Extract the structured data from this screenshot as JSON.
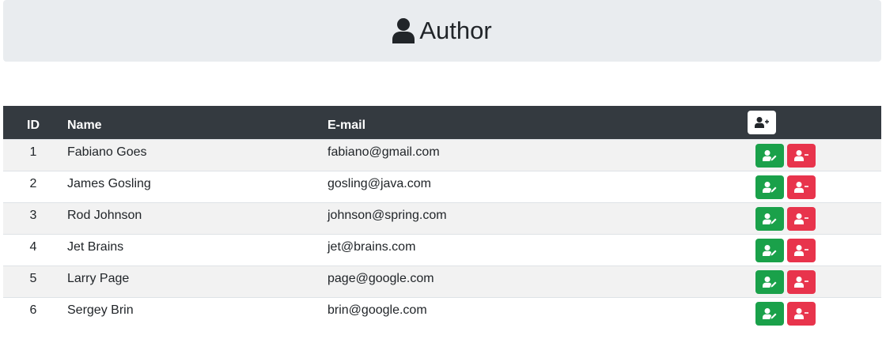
{
  "header": {
    "title": "Author",
    "icon": "user-icon"
  },
  "table": {
    "columns": {
      "id": "ID",
      "name": "Name",
      "email": "E-mail"
    },
    "add_icon": "user-plus-icon",
    "edit_icon": "user-edit-icon",
    "delete_icon": "user-minus-icon",
    "rows": [
      {
        "id": "1",
        "name": "Fabiano Goes",
        "email": "fabiano@gmail.com"
      },
      {
        "id": "2",
        "name": "James Gosling",
        "email": "gosling@java.com"
      },
      {
        "id": "3",
        "name": "Rod Johnson",
        "email": "johnson@spring.com"
      },
      {
        "id": "4",
        "name": "Jet Brains",
        "email": "jet@brains.com"
      },
      {
        "id": "5",
        "name": "Larry Page",
        "email": "page@google.com"
      },
      {
        "id": "6",
        "name": "Sergey Brin",
        "email": "brin@google.com"
      }
    ]
  },
  "colors": {
    "header_bg": "#e9ecef",
    "table_head_bg": "#343a40",
    "edit_button": "#1aa14a",
    "delete_button": "#e8344c"
  }
}
